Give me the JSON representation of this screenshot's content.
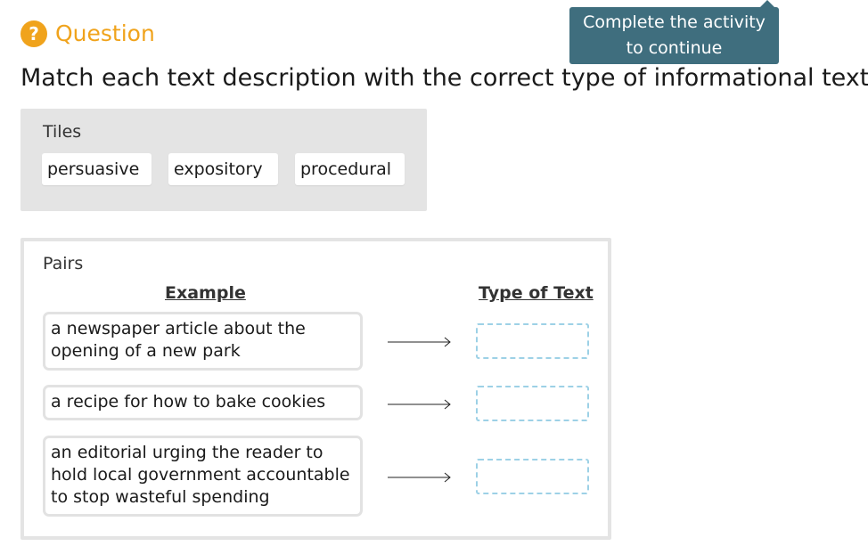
{
  "header": {
    "icon": "question-icon",
    "icon_glyph": "?",
    "label": "Question"
  },
  "tooltip": {
    "line1": "Complete the activity",
    "line2": "to continue"
  },
  "prompt": "Match each text description with the correct type of informational text.",
  "tiles": {
    "title": "Tiles",
    "items": [
      "persuasive",
      "expository",
      "procedural"
    ]
  },
  "pairs": {
    "title": "Pairs",
    "col_example": "Example",
    "col_type": "Type of Text",
    "rows": [
      {
        "example": "a newspaper article about the opening of a new park"
      },
      {
        "example": "a recipe for how to bake cookies"
      },
      {
        "example": "an editorial urging the reader to hold local government accountable to stop wasteful spending"
      }
    ]
  },
  "colors": {
    "accent": "#f0a31c",
    "tooltip_bg": "#3f6e7e",
    "panel_bg": "#e4e4e4",
    "drop_border": "#9dd1e6"
  }
}
